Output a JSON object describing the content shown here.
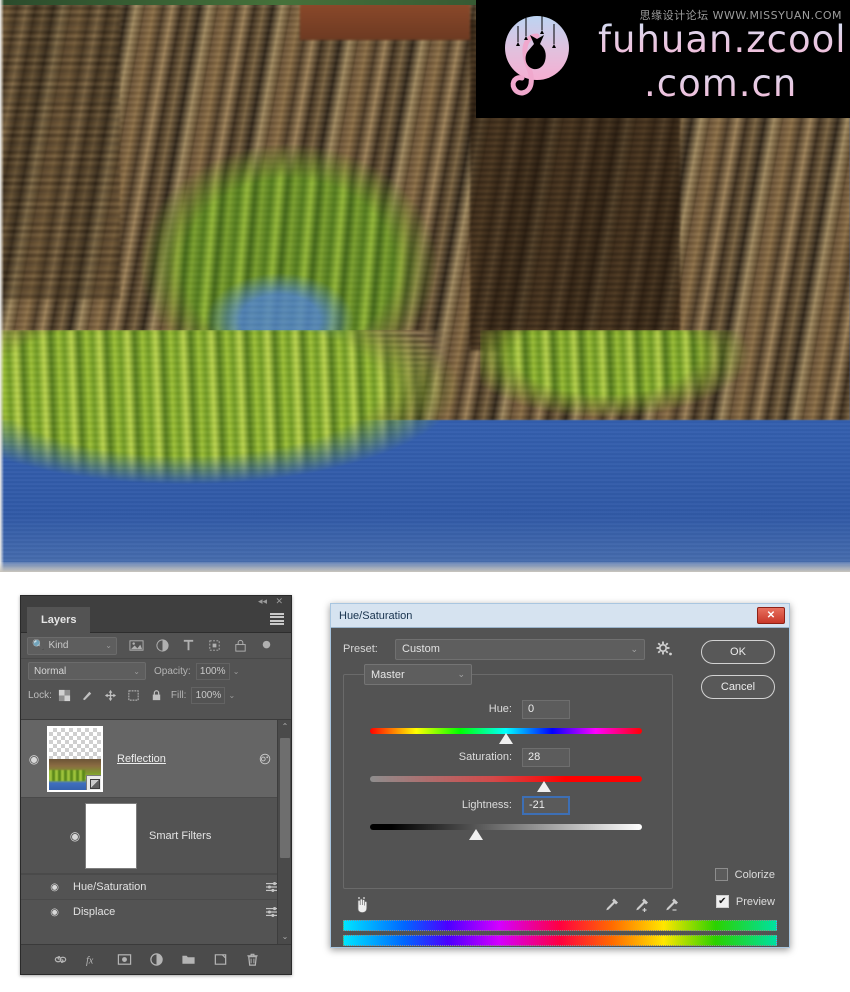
{
  "canvas": {
    "name": "photoshop-canvas",
    "description": "Water reflection photo of cliffs, green foliage and blue sky"
  },
  "watermark": {
    "site_line1": "fuhuan.zcool",
    "site_line2": ".com.cn",
    "forum_text": "思缘设计论坛 WWW.MISSYUAN.COM",
    "logo_icon": "cat-moon-logo-icon"
  },
  "layers_panel": {
    "tab_label": "Layers",
    "collapse_icon": "◂◂",
    "close_icon": "✕",
    "menu_icon": "panel-menu-icon",
    "filter": {
      "kind_label": "Kind",
      "search_icon": "magnifier-icon",
      "caret": "⌄",
      "icons": [
        "pixel-layer-filter-icon",
        "adjustment-layer-filter-icon",
        "type-layer-filter-icon",
        "shape-layer-filter-icon",
        "smart-object-filter-icon",
        "filter-toggle-icon"
      ]
    },
    "blend_mode": "Normal",
    "opacity_label": "Opacity:",
    "opacity_value": "100%",
    "lock_label": "Lock:",
    "fill_label": "Fill:",
    "fill_value": "100%",
    "lock_icons": [
      "lock-transparency-icon",
      "lock-image-icon",
      "lock-position-icon",
      "lock-artboard-icon",
      "lock-all-icon"
    ],
    "rows": [
      {
        "name": "Reflection",
        "type": "smart-object",
        "visible": true,
        "eye_icon": "◉",
        "fx_icon": "smart-filter-icon",
        "caret": "⌃"
      },
      {
        "name": "Smart Filters",
        "type": "smart-filters-group",
        "visible": true,
        "eye_icon": "◉"
      }
    ],
    "smart_filters": [
      {
        "name": "Hue/Saturation",
        "visible": true,
        "eye_icon": "◉",
        "settings_icon": "filter-settings-icon"
      },
      {
        "name": "Displace",
        "visible": true,
        "eye_icon": "◉",
        "settings_icon": "filter-settings-icon"
      }
    ],
    "bottom_icons": [
      "link-layers-icon",
      "add-layer-style-fx-icon",
      "add-layer-mask-icon",
      "new-adjustment-layer-icon",
      "new-group-icon",
      "new-layer-icon",
      "delete-layer-icon"
    ],
    "scrollbar": {
      "up_icon": "⌃",
      "down_icon": "⌄"
    }
  },
  "hue_saturation_dialog": {
    "title": "Hue/Saturation",
    "close_icon": "✕",
    "preset_label": "Preset:",
    "preset_value": "Custom",
    "preset_caret": "⌄",
    "gear_icon": "preset-options-gear-icon",
    "ok_label": "OK",
    "cancel_label": "Cancel",
    "channel_value": "Master",
    "channel_caret": "⌄",
    "sliders": [
      {
        "label": "Hue:",
        "value": "0",
        "min": -180,
        "max": 180,
        "thumb_pct": 50,
        "track": "hue-spectrum"
      },
      {
        "label": "Saturation:",
        "value": "28",
        "min": -100,
        "max": 100,
        "thumb_pct": 64,
        "track": "saturation-gradient"
      },
      {
        "label": "Lightness:",
        "value": "-21",
        "min": -100,
        "max": 100,
        "thumb_pct": 39,
        "track": "lightness-gradient"
      }
    ],
    "hand_tool_icon": "on-image-adjust-hand-icon",
    "droppers": [
      "eyedropper-icon",
      "eyedropper-add-icon",
      "eyedropper-subtract-icon"
    ],
    "colorize_label": "Colorize",
    "colorize_checked": false,
    "preview_label": "Preview",
    "preview_checked": true,
    "preview_check_glyph": "✔",
    "spectrum_bars": 2
  },
  "colors": {
    "panel_bg": "#535353",
    "row_selected": "#656565",
    "dialog_title_bg": "#d6e3f0",
    "close_red": "#c8382a",
    "focus_blue": "#3d6fb5",
    "water_blue": "#3c6cc0",
    "foliage_green": "#9cc13a"
  }
}
